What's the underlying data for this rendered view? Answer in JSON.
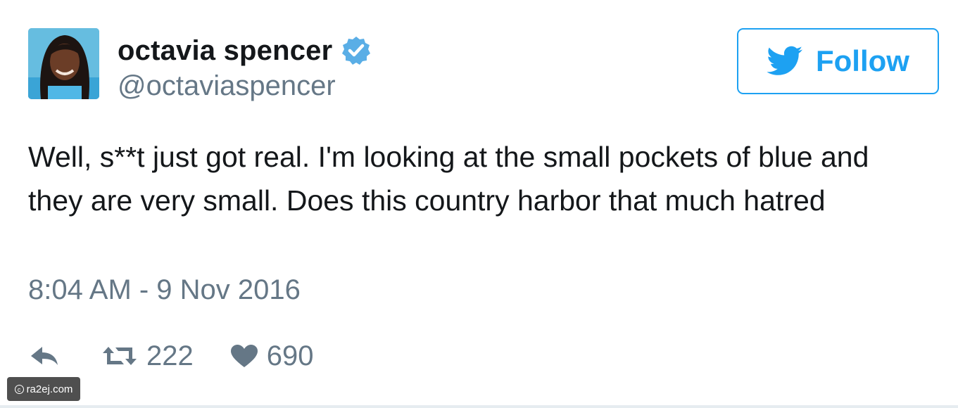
{
  "profile": {
    "display_name": "octavia spencer",
    "handle": "@octaviaspencer",
    "verified": true,
    "avatar_icon": "profile-photo"
  },
  "follow_button": {
    "label": "Follow",
    "icon": "twitter-bird-icon"
  },
  "tweet": {
    "text": "Well, s**t just got real. I'm looking at the small pockets of blue and they are very small. Does this country harbor that much hatred",
    "timestamp": "8:04 AM - 9 Nov 2016"
  },
  "actions": {
    "reply_icon": "reply-icon",
    "retweet_icon": "retweet-icon",
    "retweet_count": "222",
    "like_icon": "heart-icon",
    "like_count": "690"
  },
  "watermark": {
    "text": "ra2ej.com"
  },
  "colors": {
    "brand_blue": "#1da1f2",
    "text_primary": "#14171a",
    "text_secondary": "#657786"
  }
}
